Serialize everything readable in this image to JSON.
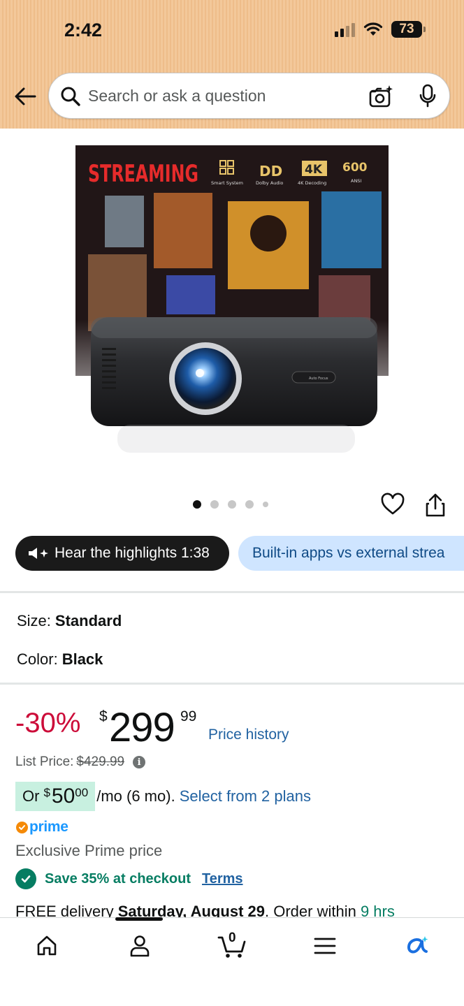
{
  "status_bar": {
    "time": "2:42",
    "battery": "73"
  },
  "search": {
    "placeholder": "Search or ask a question"
  },
  "product": {
    "image_alt": "Projector product image",
    "image_banner": {
      "headline": "STREAMING",
      "features": [
        {
          "label": "Smart System",
          "icon": "grid-icon"
        },
        {
          "label": "Dolby Audio",
          "icon": "dolby-icon"
        },
        {
          "label": "4K Decoding",
          "icon": "4k-badge"
        },
        {
          "label": "ANSI",
          "value": "600"
        }
      ],
      "projector_label": "Auto Focus"
    },
    "carousel": {
      "count": 5,
      "active_index": 0
    }
  },
  "pills": {
    "highlights": "Hear the highlights 1:38",
    "apps": "Built-in apps vs external strea"
  },
  "variants": {
    "size_label": "Size:",
    "size_value": "Standard",
    "color_label": "Color:",
    "color_value": "Black"
  },
  "pricing": {
    "discount": "-30%",
    "currency": "$",
    "price_whole": "299",
    "price_fraction": "99",
    "price_history": "Price history",
    "list_price_label": "List Price:",
    "list_price": "$429.99",
    "installment_prefix": "Or",
    "installment_currency": "$",
    "installment_whole": "50",
    "installment_fraction": "00",
    "installment_suffix": "/mo (6 mo).",
    "installment_link": "Select from 2 plans"
  },
  "prime": {
    "logo_text": "prime",
    "exclusive": "Exclusive Prime price",
    "save_text": "Save 35% at checkout",
    "terms": "Terms"
  },
  "delivery": {
    "prefix": "FREE delivery",
    "date": "Saturday, August 29",
    "middle": ". Order within",
    "remaining": "9 hrs"
  },
  "bottom_nav": {
    "cart_count": "0"
  },
  "colors": {
    "header_bg": "#f3c89a",
    "discount_red": "#cc0c39",
    "link_blue": "#2162a1",
    "success_green": "#067d62",
    "prime_blue": "#1a98ff"
  }
}
